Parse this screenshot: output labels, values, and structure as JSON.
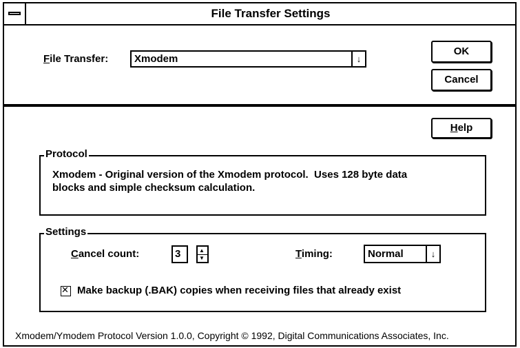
{
  "window": {
    "title": "File Transfer Settings"
  },
  "file_transfer": {
    "label_mnemonic": "F",
    "label_rest": "ile Transfer:",
    "value": "Xmodem"
  },
  "buttons": {
    "ok": "OK",
    "cancel": "Cancel",
    "help_mnemonic": "H",
    "help_rest": "elp"
  },
  "protocol": {
    "group_label": "Protocol",
    "description_line1": "Xmodem - Original version of the Xmodem protocol.  Uses 128 byte data",
    "description_line2": "blocks and simple checksum calculation."
  },
  "settings": {
    "group_label": "Settings",
    "cancel_count_mnemonic": "C",
    "cancel_count_rest": "ancel count:",
    "cancel_count_value": "3",
    "timing_mnemonic": "T",
    "timing_rest": "iming:",
    "timing_value": "Normal",
    "backup_checked": true,
    "backup_label": "Make backup (.BAK) copies when receiving files that already exist"
  },
  "footer": {
    "version_text": "Xmodem/Ymodem Protocol Version 1.0.0, Copyright © 1992, Digital Communications Associates, Inc."
  },
  "icons": {
    "dropdown_arrow": "↓",
    "spin_up": "▲",
    "spin_down": "▼",
    "checkbox_mark": "✕"
  }
}
